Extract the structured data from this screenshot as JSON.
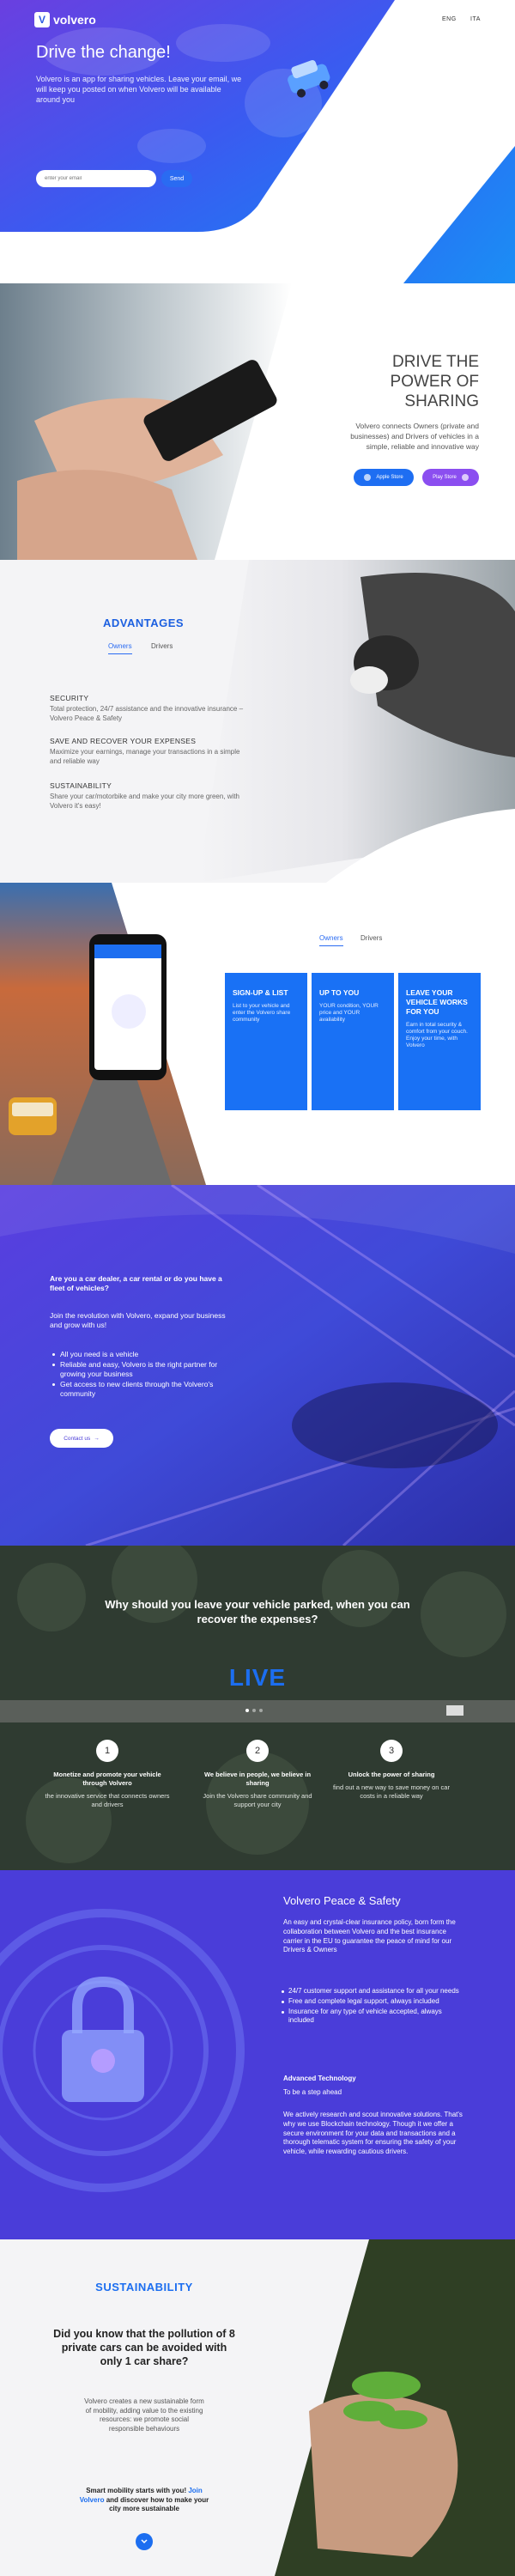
{
  "brand": {
    "name": "volvero",
    "mark": "V"
  },
  "lang": [
    "ENG",
    "ITA"
  ],
  "hero": {
    "title": "Drive the change!",
    "text": "Volvero is an app for sharing vehicles. Leave your email, we will keep you posted on when Volvero will be available around you",
    "email_placeholder": "enter your email",
    "send": "Send"
  },
  "share": {
    "title": "DRIVE THE POWER OF SHARING",
    "text": "Volvero connects Owners (private and businesses) and Drivers of vehicles in a simple, reliable and innovative way",
    "apple": "Apple Store",
    "play": "Play Store"
  },
  "advantages": {
    "title": "ADVANTAGES",
    "tabs": [
      "Owners",
      "Drivers"
    ],
    "items": [
      {
        "h": "SECURITY",
        "t": "Total protection, 24/7 assistance and the innovative insurance – Volvero Peace & Safety"
      },
      {
        "h": "SAVE AND RECOVER YOUR EXPENSES",
        "t": "Maximize your earnings, manage your transactions in a simple and reliable way"
      },
      {
        "h": "SUSTAINABILITY",
        "t": "Share your car/motorbike and make your city more green, with Volvero it's easy!"
      }
    ]
  },
  "cards": {
    "tabs": [
      "Owners",
      "Drivers"
    ],
    "items": [
      {
        "h": "SIGN-UP & LIST",
        "t": "List to your vehicle and enter the Volvero share community"
      },
      {
        "h": "UP TO YOU",
        "t": "YOUR condition, YOUR price and YOUR availability"
      },
      {
        "h": "LEAVE YOUR VEHICLE WORKS FOR YOU",
        "t": "Earn in total security & comfort from your couch. Enjoy your time, with Volvero"
      }
    ]
  },
  "dealer": {
    "question": "Are you a car dealer, a car rental or do you have a fleet of vehicles?",
    "sub": "Join the revolution with Volvero, expand your business and grow with us!",
    "list": [
      "All you need is a vehicle",
      "Reliable and easy, Volvero is the right partner for growing your business",
      "Get access to new clients through the Volvero's community"
    ],
    "contact": "Contact us"
  },
  "live": {
    "question": "Why should you leave your vehicle parked, when you can recover the expenses?",
    "word": "LIVE",
    "features": [
      {
        "n": "1",
        "h": "Monetize and promote your vehicle through Volvero",
        "t": "the innovative service that connects owners and drivers"
      },
      {
        "n": "2",
        "h": "We believe in people, we believe in sharing",
        "t": "Join the Volvero share community and support your city"
      },
      {
        "n": "3",
        "h": "Unlock the power of sharing",
        "t": "find out a new way to save money on car costs in a reliable way"
      }
    ]
  },
  "peace": {
    "title": "Volvero Peace & Safety",
    "intro": "An easy and crystal-clear insurance policy, born form the collaboration between Volvero and the best insurance carrier in the EU to guarantee the peace of mind for our Drivers & Owners",
    "list": [
      "24/7 customer support and assistance for all your needs",
      "Free and complete legal support, always included",
      "Insurance for any type of vehicle accepted, always included"
    ],
    "sub_h": "Advanced Technology",
    "sub_t": "To be a step ahead",
    "body": "We actively research and scout innovative solutions. That's why we use Blockchain technology. Though it we offer a secure environment for your data and transactions and a thorough telematic system for ensuring the safety of your vehicle, while rewarding cautious drivers."
  },
  "sust": {
    "title": "SUSTAINABILITY",
    "question": "Did you know that the pollution of 8 private cars can be avoided with only 1 car share?",
    "text": "Volvero creates a new sustainable form of mobility, adding value to the existing resources: we promote social responsible behaviours",
    "b1": "Smart mobility starts with you!",
    "b2": "Join Volvero",
    "b3": "and discover how to make your city more sustainable"
  },
  "colors": {
    "blue": "#1c6ef0",
    "purple": "#4a3dd9"
  }
}
